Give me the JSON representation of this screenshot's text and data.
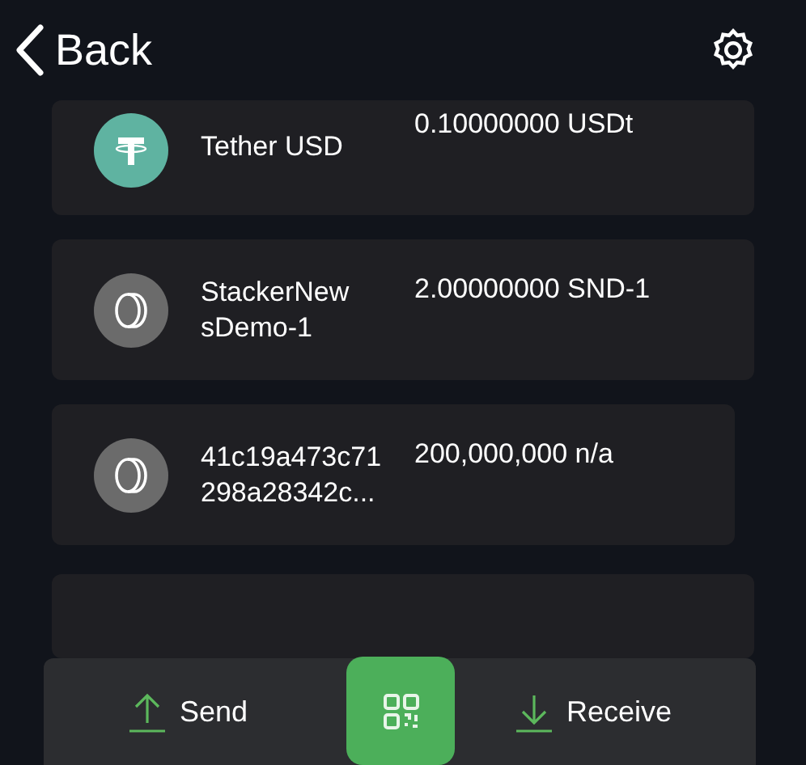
{
  "header": {
    "back_label": "Back"
  },
  "tokens": [
    {
      "kind": "tether",
      "name": "Tether USD",
      "amount": "0.10000000 USDt"
    },
    {
      "kind": "coin",
      "name": "StackerNew sDemo-1",
      "amount": "2.00000000 SND-1"
    },
    {
      "kind": "coin",
      "name": "41c19a473c71 298a28342c...",
      "amount": "200,000,000 n/a"
    }
  ],
  "bottom_bar": {
    "send_label": "Send",
    "receive_label": "Receive"
  }
}
